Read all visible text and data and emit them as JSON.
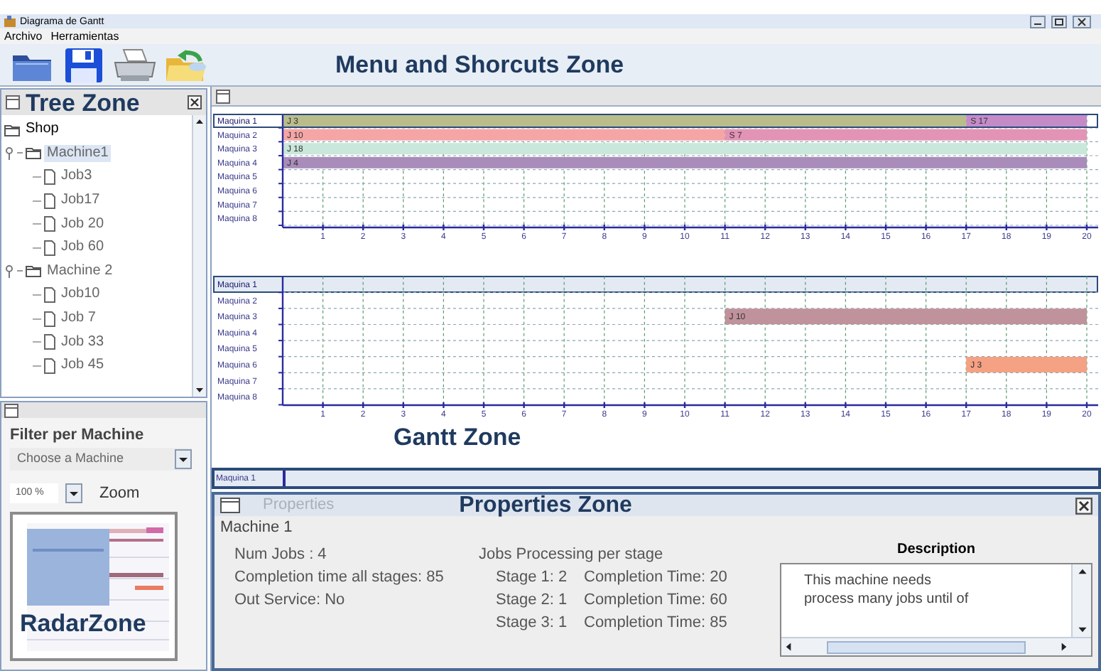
{
  "window": {
    "title": "Diagrama de Gantt"
  },
  "menu": [
    "Archivo",
    "Herramientas"
  ],
  "toolbar": {
    "buttons": [
      {
        "kind": "open"
      },
      {
        "kind": "save"
      },
      {
        "kind": "print"
      },
      {
        "kind": "import"
      }
    ],
    "zone_label": "Menu and Shorcuts Zone"
  },
  "tree_panel": {
    "zone_label": "Tree Zone",
    "tree": [
      {
        "label": "Shop",
        "kind": "root",
        "selected": false,
        "children": [
          {
            "label": "Machine1",
            "kind": "machine",
            "selected": true,
            "expanded": true,
            "children": [
              {
                "label": "Job3",
                "kind": "job",
                "selected": false
              },
              {
                "label": "Job17",
                "kind": "job",
                "selected": false
              },
              {
                "label": "Job 20",
                "kind": "job",
                "selected": false
              },
              {
                "label": "Job 60",
                "kind": "job",
                "selected": false
              }
            ]
          },
          {
            "label": "Machine 2",
            "kind": "machine",
            "selected": false,
            "expanded": true,
            "children": [
              {
                "label": "Job10",
                "kind": "job",
                "selected": false
              },
              {
                "label": "Job 7",
                "kind": "job",
                "selected": false
              },
              {
                "label": "Job 33",
                "kind": "job",
                "selected": false
              },
              {
                "label": "Job 45",
                "kind": "job",
                "selected": false
              }
            ]
          }
        ]
      }
    ]
  },
  "filter_panel": {
    "title": "Filter per Machine",
    "machine_dropdown": {
      "value": "Choose a Machine"
    },
    "zoom_dropdown": {
      "value": "100 %"
    },
    "zoom_label": "Zoom",
    "radar": {
      "zone_label": "RadarZone"
    }
  },
  "gantt_panel": {
    "zone_label": "Gantt Zone",
    "charts": [
      {
        "row_selected": [
          true,
          false,
          false,
          false,
          false,
          false,
          false,
          false
        ],
        "chart_data": {
          "type": "bar",
          "orientation": "horizontal",
          "stacked": true,
          "grid": true,
          "categories": [
            "Maquina 1",
            "Maquina 2",
            "Maquina 3",
            "Maquina 4",
            "Maquina 5",
            "Maquina 6",
            "Maquina 7",
            "Maquina 8"
          ],
          "xlim": [
            0,
            20
          ],
          "xticks": [
            1,
            2,
            3,
            4,
            5,
            6,
            7,
            8,
            9,
            10,
            11,
            12,
            13,
            14,
            15,
            16,
            17,
            18,
            19,
            20
          ],
          "series": [
            {
              "name": "J 3",
              "color": "#b9bd8c",
              "values": [
                17,
                null,
                null,
                null,
                null,
                null,
                null,
                null
              ]
            },
            {
              "name": "S 17",
              "color": "#c58bc9",
              "values": [
                3,
                null,
                null,
                null,
                null,
                null,
                null,
                null
              ]
            },
            {
              "name": "J 10",
              "color": "#f5a5a5",
              "values": [
                null,
                11,
                null,
                null,
                null,
                null,
                null,
                null
              ]
            },
            {
              "name": "S 7",
              "color": "#e393b5",
              "values": [
                null,
                9,
                null,
                null,
                null,
                null,
                null,
                null
              ]
            },
            {
              "name": "J 18",
              "color": "#c9e7da",
              "values": [
                null,
                null,
                20,
                null,
                null,
                null,
                null,
                null
              ]
            },
            {
              "name": "J 4",
              "color": "#a98cba",
              "values": [
                null,
                null,
                null,
                20,
                null,
                null,
                null,
                null
              ]
            }
          ]
        }
      },
      {
        "row_selected": [
          true,
          false,
          false,
          false,
          false,
          false,
          false,
          false
        ],
        "chart_data": {
          "type": "bar",
          "orientation": "horizontal",
          "stacked": false,
          "grid": true,
          "categories": [
            "Maquina 1",
            "Maquina 2",
            "Maquina 3",
            "Maquina 4",
            "Maquina 5",
            "Maquina 6",
            "Maquina 7",
            "Maquina 8"
          ],
          "xlim": [
            0,
            20
          ],
          "xticks": [
            1,
            2,
            3,
            4,
            5,
            6,
            7,
            8,
            9,
            10,
            11,
            12,
            13,
            14,
            15,
            16,
            17,
            18,
            19,
            20
          ],
          "series": [
            {
              "name": "J 10",
              "color": "#c0929c",
              "values": [
                null,
                null,
                9,
                null,
                null,
                null,
                null,
                null
              ],
              "base": [
                null,
                null,
                11,
                null,
                null,
                null,
                null,
                null
              ]
            },
            {
              "name": "J 3",
              "color": "#f5a183",
              "values": [
                null,
                null,
                null,
                null,
                null,
                3,
                null,
                null
              ],
              "base": [
                null,
                null,
                null,
                null,
                null,
                17,
                null,
                null
              ]
            }
          ]
        }
      }
    ],
    "partial_row": "Maquina 1"
  },
  "properties_panel": {
    "title": "Properties",
    "zone_label": "Properties Zone",
    "machine": "Machine 1",
    "summary": [
      "Num Jobs : 4",
      "Completion time all stages: 85",
      "Out Service: No"
    ],
    "stages_heading": "Jobs Processing per stage",
    "stages": [
      {
        "stage": "Stage 1: 2",
        "completion": "Completion Time: 20"
      },
      {
        "stage": "Stage 2: 1",
        "completion": "Completion Time: 60"
      },
      {
        "stage": "Stage 3: 1",
        "completion": "Completion Time: 85"
      }
    ],
    "description": {
      "heading": "Description",
      "lines": [
        "This machine needs",
        "process many jobs until of"
      ]
    }
  }
}
